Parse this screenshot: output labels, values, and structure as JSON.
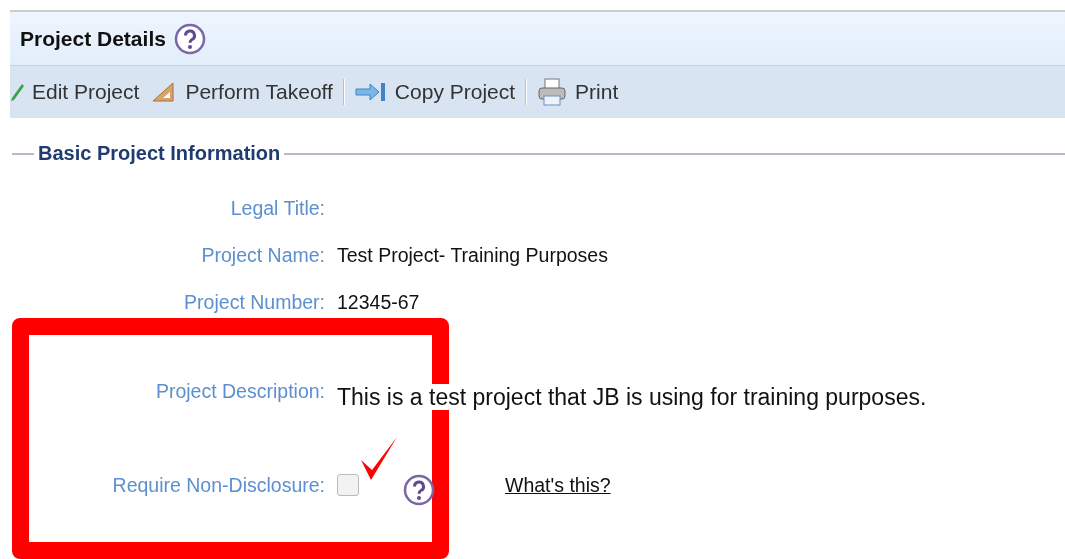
{
  "panel": {
    "title": "Project Details"
  },
  "toolbar": [
    {
      "kind": "edit",
      "label": "Edit Project"
    },
    {
      "kind": "takeoff",
      "label": "Perform Takeoff"
    },
    {
      "kind": "copy",
      "label": "Copy Project"
    },
    {
      "kind": "print",
      "label": "Print"
    }
  ],
  "section": {
    "title": "Basic Project Information",
    "fields": [
      {
        "kind": "text",
        "label": "Legal Title:"
      },
      {
        "kind": "text",
        "label": "Project Name:",
        "value": "Test Project- Training Purposes"
      },
      {
        "kind": "text",
        "label": "Project Number:",
        "value": "12345-67"
      },
      {
        "kind": "description",
        "label": "Project Description:",
        "value": "This is a test project that JB is using for training purposes."
      },
      {
        "kind": "checkbox",
        "label": "Require Non-Disclosure:",
        "checked": false,
        "link": "What's this?"
      }
    ]
  }
}
